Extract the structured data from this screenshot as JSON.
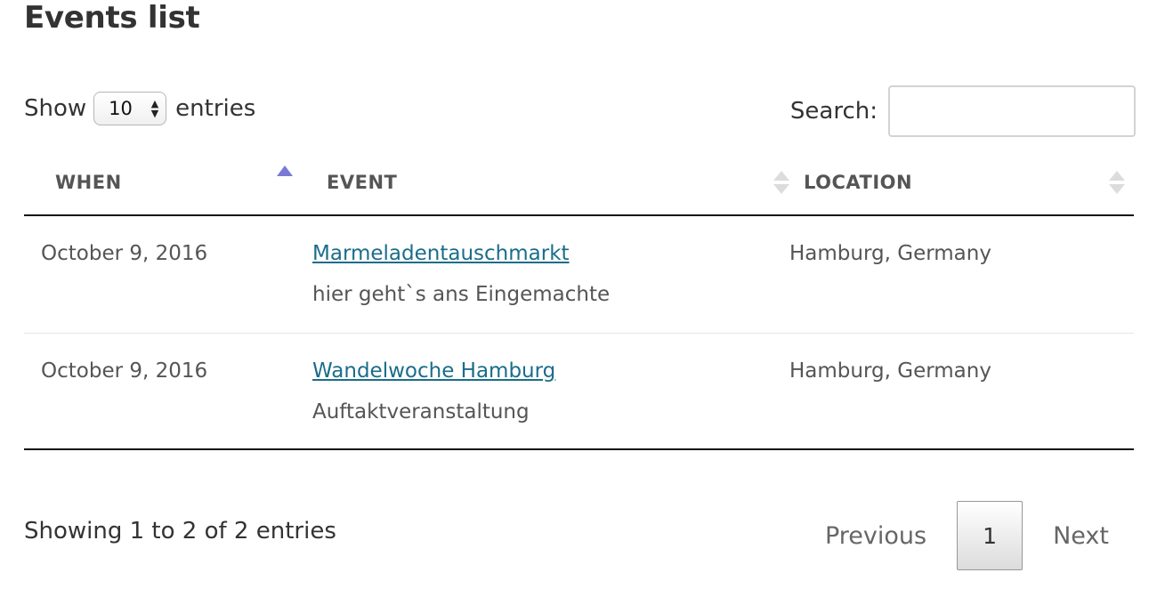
{
  "page": {
    "title": "Events list"
  },
  "length_control": {
    "prefix": "Show",
    "selected": "10",
    "suffix": "entries"
  },
  "search": {
    "label": "Search:",
    "value": "",
    "placeholder": ""
  },
  "table": {
    "columns": [
      {
        "label": "WHEN",
        "sort": "ascending"
      },
      {
        "label": "EVENT",
        "sort": "none"
      },
      {
        "label": "LOCATION",
        "sort": "none"
      }
    ],
    "rows": [
      {
        "when": "October 9, 2016",
        "event_title": "Marmeladentauschmarkt",
        "event_description": "hier geht`s ans Eingemachte",
        "location": "Hamburg, Germany"
      },
      {
        "when": "October 9, 2016",
        "event_title": "Wandelwoche Hamburg",
        "event_description": "Auftaktveranstaltung",
        "location": "Hamburg, Germany"
      }
    ]
  },
  "footer": {
    "info": "Showing 1 to 2 of 2 entries",
    "pagination": {
      "previous": "Previous",
      "current_page": "1",
      "next": "Next"
    }
  },
  "colors": {
    "link": "#1b6d8a",
    "sort_active": "#7a7ad6",
    "sort_inactive": "#dcdcdc",
    "text": "#333333",
    "muted": "#555555"
  }
}
